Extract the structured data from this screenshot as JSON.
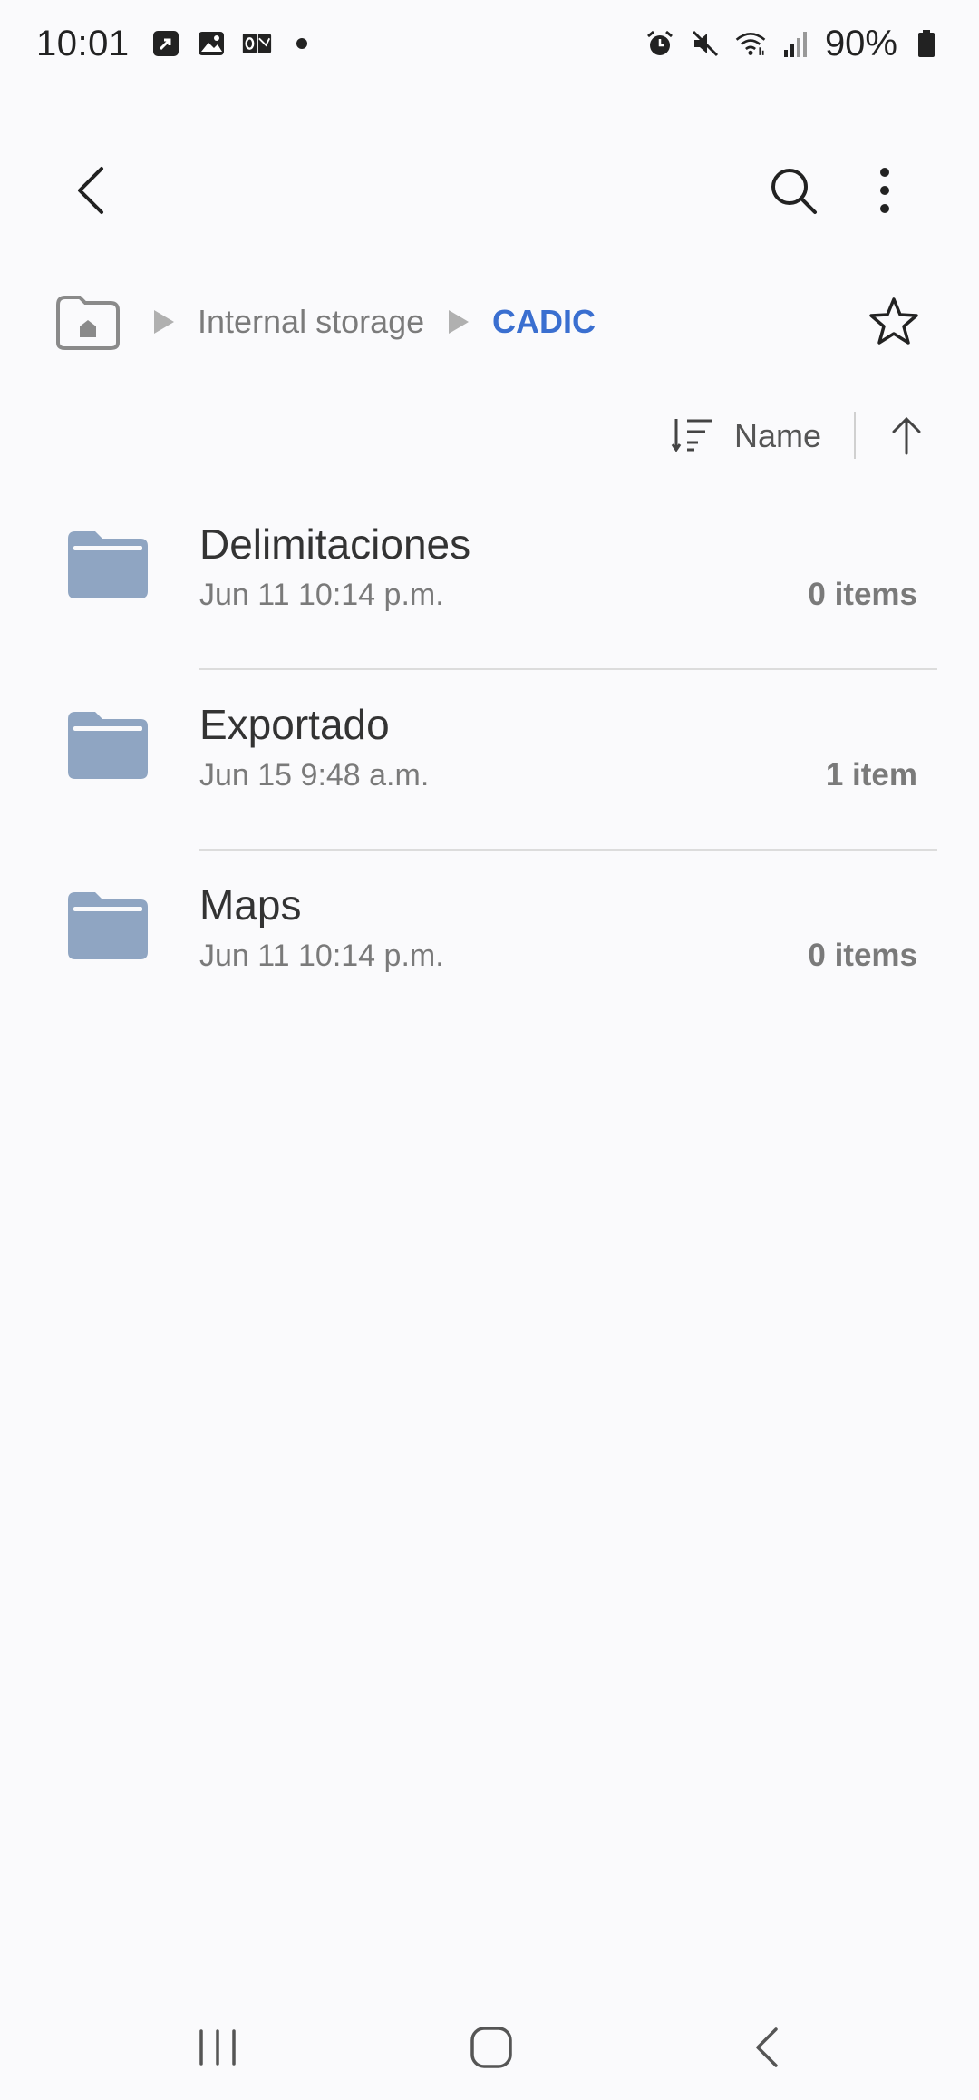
{
  "status_bar": {
    "time": "10:01",
    "battery": "90%",
    "left_icons": [
      "missed-call-icon",
      "gallery-icon",
      "outlook-icon",
      "dot-icon"
    ],
    "right_icons": [
      "alarm-icon",
      "mute-icon",
      "wifi-icon",
      "signal-icon",
      "battery-icon"
    ]
  },
  "app_bar": {
    "icons": [
      "back-icon",
      "search-icon",
      "more-vert-icon"
    ]
  },
  "breadcrumb": {
    "home_icon": "home-folder-icon",
    "items": [
      "Internal storage",
      "CADIC"
    ],
    "favorite_icon": "star-outline-icon"
  },
  "sort": {
    "label": "Name",
    "direction": "ascending",
    "icon": "sort-icon"
  },
  "folders": [
    {
      "name": "Delimitaciones",
      "date": "Jun 11 10:14 p.m.",
      "count": "0 items"
    },
    {
      "name": "Exportado",
      "date": "Jun 15 9:48 a.m.",
      "count": "1 item"
    },
    {
      "name": "Maps",
      "date": "Jun 11 10:14 p.m.",
      "count": "0 items"
    }
  ],
  "colors": {
    "background": "#fafafc",
    "accent": "#3a6fd0",
    "folder": "#8fa5c2"
  },
  "nav_bar": {
    "icons": [
      "recent-apps-icon",
      "home-icon",
      "back-icon"
    ]
  }
}
